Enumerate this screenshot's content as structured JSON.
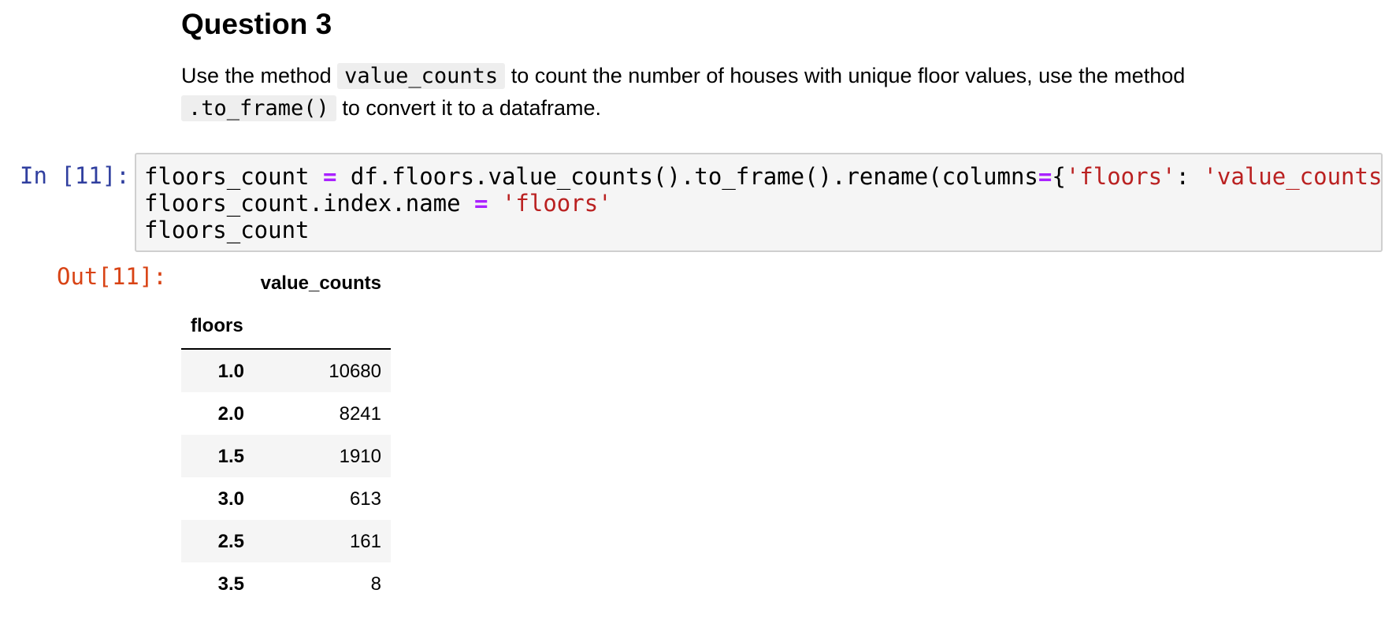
{
  "markdown": {
    "heading": "Question 3",
    "para_1": "Use the method ",
    "code_1": "value_counts",
    "para_2": " to count the number of houses with unique floor values, use the method ",
    "code_2": ".to_frame()",
    "para_3": " to convert it to a dataframe."
  },
  "input_cell": {
    "prompt": "In [11]:",
    "line1": {
      "t1": "floors_count ",
      "op1": "=",
      "t2": " df.floors.value_counts().to_frame().rename(columns",
      "op2": "=",
      "t3": "{",
      "s1": "'floors'",
      "t4": ": ",
      "s2": "'value_counts'",
      "t5": "})"
    },
    "line2": {
      "t1": "floors_count.index.name ",
      "op1": "=",
      "t2": " ",
      "s1": "'floors'"
    },
    "line3": "floors_count"
  },
  "output_cell": {
    "prompt": "Out[11]:",
    "column_header": "value_counts",
    "index_name": "floors",
    "rows": [
      {
        "index": "1.0",
        "value": "10680"
      },
      {
        "index": "2.0",
        "value": "8241"
      },
      {
        "index": "1.5",
        "value": "1910"
      },
      {
        "index": "3.0",
        "value": "613"
      },
      {
        "index": "2.5",
        "value": "161"
      },
      {
        "index": "3.5",
        "value": "8"
      }
    ]
  },
  "colors": {
    "in_prompt": "#303f9f",
    "out_prompt": "#d84315",
    "operator": "#aa22ff",
    "string": "#ba2121",
    "code_bg": "#f5f5f5"
  }
}
